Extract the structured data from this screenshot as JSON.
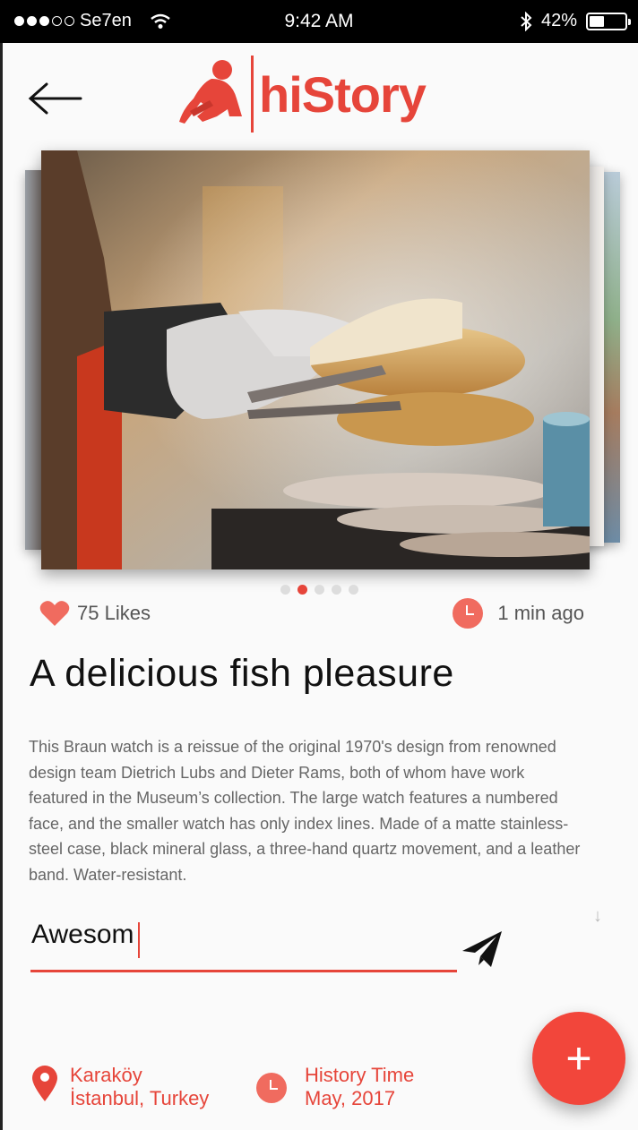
{
  "status_bar": {
    "carrier": "Se7en",
    "time": "9:42 AM",
    "battery": "42%",
    "battery_level": 0.42
  },
  "header": {
    "logo_text": "hiStory",
    "accent_color": "#e6453a"
  },
  "carousel": {
    "page_count": 5,
    "active_index": 1
  },
  "post": {
    "likes": "75 Likes",
    "time_ago": "1 min ago",
    "title": "A delicious fish pleasure",
    "description": "This Braun watch is a reissue of the original 1970's design from renowned design team Dietrich Lubs and Dieter Rams, both of whom have work featured in the Museum’s collection. The large watch features a numbered face, and the smaller watch has only index lines. Made of a matte stainless-steel case, black mineral glass, a three-hand quartz movement, and a leather band. Water-resistant."
  },
  "comment": {
    "value": "Awesom"
  },
  "footer": {
    "location_line1": "Karaköy",
    "location_line2": "İstanbul, Turkey",
    "history_line1": "History Time",
    "history_line2": "May, 2017"
  },
  "fab": {
    "label": "+"
  },
  "icons": {
    "back": "arrow-left-icon",
    "like": "heart-icon",
    "clock": "clock-icon",
    "send": "paper-plane-icon",
    "location": "map-pin-icon"
  }
}
